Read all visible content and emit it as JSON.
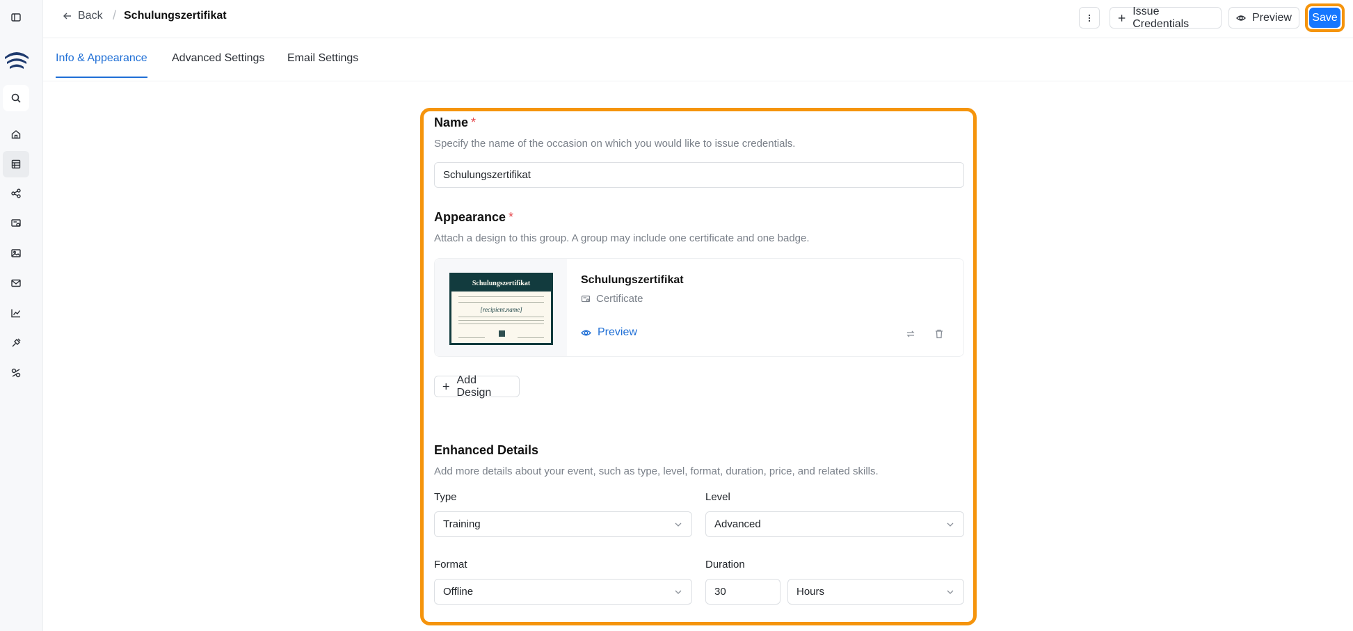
{
  "header": {
    "back_label": "Back",
    "separator": "/",
    "title": "Schulungszertifikat",
    "issue_label": "Issue Credentials",
    "preview_label": "Preview",
    "save_label": "Save"
  },
  "tabs": [
    {
      "label": "Info & Appearance",
      "active": true
    },
    {
      "label": "Advanced Settings",
      "active": false
    },
    {
      "label": "Email Settings",
      "active": false
    }
  ],
  "name_section": {
    "label": "Name",
    "required": "*",
    "description": "Specify the name of the occasion on which you would like to issue credentials.",
    "value": "Schulungszertifikat"
  },
  "appearance": {
    "label": "Appearance",
    "required": "*",
    "description": "Attach a design to this group. A group may include one certificate and one badge.",
    "design": {
      "title": "Schulungszertifikat",
      "type": "Certificate",
      "preview_label": "Preview",
      "thumbnail_title": "Schulungszertifikat",
      "thumbnail_name": "[recipient.name]"
    },
    "add_design_label": "Add Design"
  },
  "enhanced": {
    "title": "Enhanced Details",
    "description": "Add more details about your event, such as type, level, format, duration, price, and related skills.",
    "type_label": "Type",
    "type_value": "Training",
    "level_label": "Level",
    "level_value": "Advanced",
    "format_label": "Format",
    "format_value": "Offline",
    "duration_label": "Duration",
    "duration_value": "30",
    "duration_unit": "Hours"
  },
  "colors": {
    "accent": "#1677ff",
    "highlight": "#f5940c",
    "link": "#1f6fd6"
  }
}
